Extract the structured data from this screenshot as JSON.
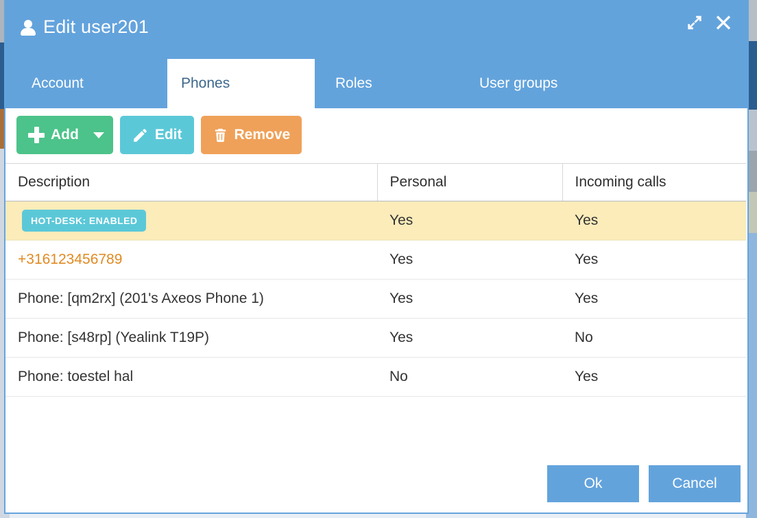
{
  "window": {
    "title": "Edit user201",
    "icon": "user-icon",
    "expand_icon": "expand-arrows-icon",
    "close_icon": "close-icon"
  },
  "tabs": [
    {
      "label": "Account",
      "active": false
    },
    {
      "label": "Phones",
      "active": true
    },
    {
      "label": "Roles",
      "active": false
    },
    {
      "label": "User groups",
      "active": false
    }
  ],
  "toolbar": {
    "add_label": "Add",
    "add_icon": "plus-icon",
    "add_caret_icon": "chevron-down-icon",
    "edit_label": "Edit",
    "edit_icon": "pencil-icon",
    "remove_label": "Remove",
    "remove_icon": "trash-icon"
  },
  "table": {
    "columns": [
      "Description",
      "Personal",
      "Incoming calls"
    ],
    "rows": [
      {
        "kind": "badge",
        "badge_text": "HOT-DESK: ENABLED",
        "description": "",
        "personal": "Yes",
        "incoming": "Yes",
        "highlight": true
      },
      {
        "kind": "link",
        "description": "+316123456789",
        "personal": "Yes",
        "incoming": "Yes",
        "highlight": false
      },
      {
        "kind": "text",
        "description": "Phone: [qm2rx] (201's Axeos Phone 1)",
        "personal": "Yes",
        "incoming": "Yes",
        "highlight": false
      },
      {
        "kind": "text",
        "description": "Phone: [s48rp] (Yealink T19P)",
        "personal": "Yes",
        "incoming": "No",
        "highlight": false
      },
      {
        "kind": "text",
        "description": "Phone: toestel hal",
        "personal": "No",
        "incoming": "Yes",
        "highlight": false
      }
    ]
  },
  "footer": {
    "ok_label": "Ok",
    "cancel_label": "Cancel"
  },
  "colors": {
    "header_blue": "#63a3dc",
    "add_green": "#4cc38a",
    "edit_cyan": "#5bc8d8",
    "remove_orange": "#efa159",
    "row_highlight": "#fbecba",
    "link_orange": "#e08a22",
    "badge_cyan": "#5bc8d8"
  }
}
